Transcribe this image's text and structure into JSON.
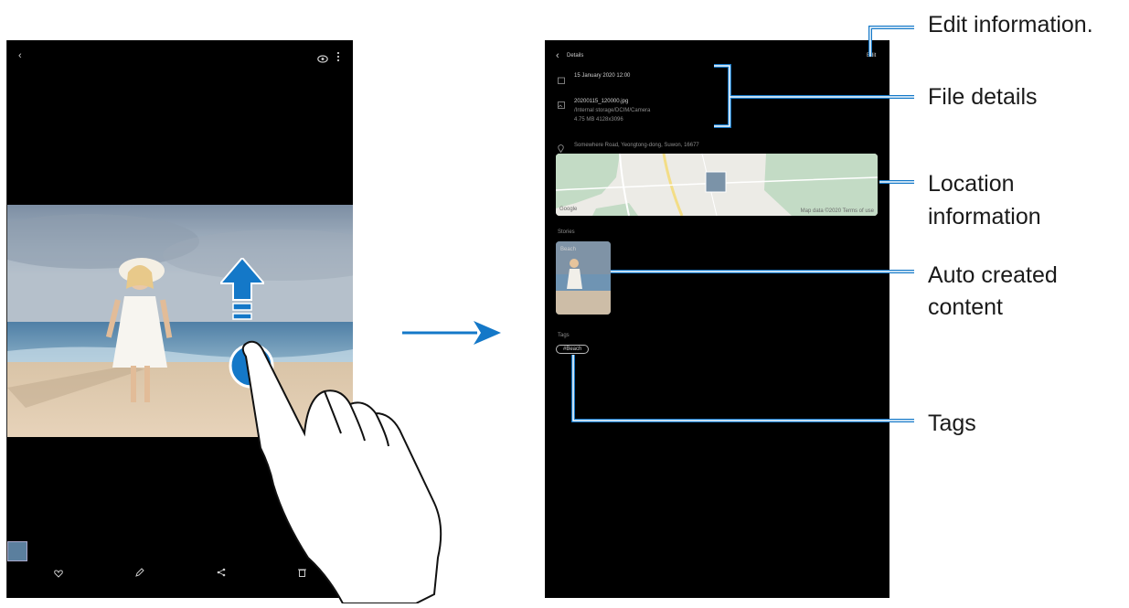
{
  "gallery_view": {
    "back_icon": "back-icon",
    "actions": [
      "eye-icon",
      "more-vert-icon"
    ],
    "bottom_toolbar": [
      "heart-icon",
      "pencil-icon",
      "share-icon",
      "trash-icon"
    ]
  },
  "details_screen": {
    "title": "Details",
    "edit_label": "Edit",
    "date_text": "15 January 2020 12:00",
    "file_name": "20200115_120000.jpg",
    "file_path": "/Internal storage/DCIM/Camera",
    "file_meta": "4.75 MB    4128x3096",
    "location_text": "Somewhere Road, Yeongtong-dong, Suwon, 16677",
    "stories_heading": "Stories",
    "story_caption": "Beach",
    "tags_heading": "Tags",
    "tag_chip": "#Beach",
    "map_attribution": "Google",
    "map_copyright": "Map data ©2020  Terms of use"
  },
  "callouts": {
    "edit_information": "Edit information.",
    "file_details": "File details",
    "location_line1": "Location",
    "location_line2": "information",
    "auto_line1": "Auto created",
    "auto_line2": "content",
    "tags": "Tags"
  },
  "colors": {
    "accent_blue": "#1478c8",
    "screen_black": "#000000",
    "map_green": "#c3dbc5",
    "map_road": "#f3dd86"
  }
}
